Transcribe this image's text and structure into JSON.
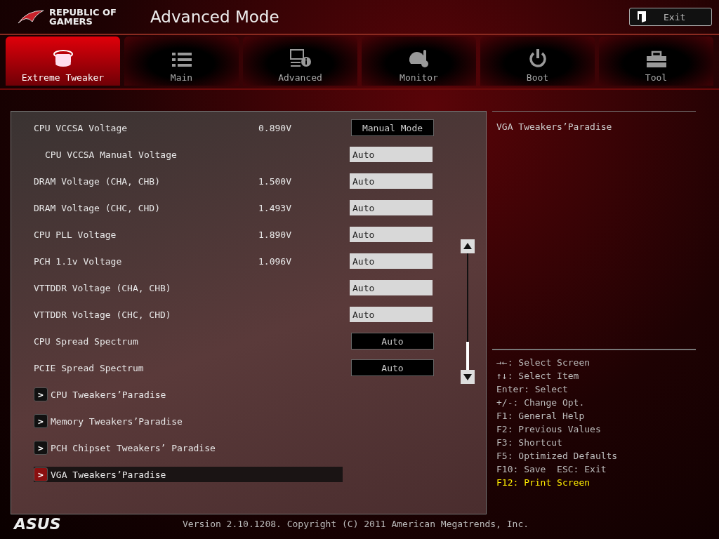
{
  "header": {
    "logo_line1": "REPUBLIC OF",
    "logo_line2": "GAMERS",
    "title": "Advanced Mode",
    "exit_button": "Exit"
  },
  "tabs": [
    {
      "label": "Extreme Tweaker",
      "kind": "tweaker",
      "selected": true
    },
    {
      "label": "Main",
      "kind": "list",
      "selected": false
    },
    {
      "label": "Advanced",
      "kind": "info",
      "selected": false
    },
    {
      "label": "Monitor",
      "kind": "gauge",
      "selected": false
    },
    {
      "label": "Boot",
      "kind": "power",
      "selected": false
    },
    {
      "label": "Tool",
      "kind": "toolbox",
      "selected": false
    }
  ],
  "settings": [
    {
      "kind": "dropdown",
      "name": "CPU VCCSA Voltage",
      "reading": "0.890V",
      "value": "Manual Mode",
      "children": [
        {
          "kind": "input",
          "name": "CPU VCCSA Manual Voltage",
          "value": "Auto"
        }
      ]
    },
    {
      "kind": "input",
      "name": "DRAM Voltage (CHA, CHB)",
      "reading": "1.500V",
      "value": "Auto"
    },
    {
      "kind": "input",
      "name": "DRAM Voltage (CHC, CHD)",
      "reading": "1.493V",
      "value": "Auto"
    },
    {
      "kind": "input",
      "name": "CPU PLL Voltage",
      "reading": "1.890V",
      "value": "Auto"
    },
    {
      "kind": "input",
      "name": "PCH 1.1v Voltage",
      "reading": "1.096V",
      "value": "Auto"
    },
    {
      "kind": "input",
      "name": "VTTDDR Voltage (CHA, CHB)",
      "value": "Auto"
    },
    {
      "kind": "input",
      "name": "VTTDDR Voltage (CHC, CHD)",
      "value": "Auto"
    },
    {
      "kind": "dropdown",
      "name": "CPU Spread Spectrum",
      "value": "Auto"
    },
    {
      "kind": "dropdown",
      "name": "PCIE Spread Spectrum",
      "value": "Auto"
    },
    {
      "kind": "submenu",
      "name": "CPU Tweakers’Paradise",
      "arrow": ">",
      "selected": false
    },
    {
      "kind": "submenu",
      "name": "Memory Tweakers’Paradise",
      "arrow": ">",
      "selected": false
    },
    {
      "kind": "submenu",
      "name": "PCH Chipset Tweakers’ Paradise",
      "arrow": ">",
      "selected": false
    },
    {
      "kind": "submenu",
      "name": "VGA Tweakers’Paradise",
      "arrow": ">",
      "selected": true
    }
  ],
  "help": {
    "text": "VGA Tweakers’Paradise"
  },
  "keys": [
    {
      "text": "→←: Select Screen",
      "highlighted": false
    },
    {
      "text": "↑↓: Select Item",
      "highlighted": false
    },
    {
      "text": "Enter: Select",
      "highlighted": false
    },
    {
      "text": "+/-: Change Opt.",
      "highlighted": false
    },
    {
      "text": "F1: General Help",
      "highlighted": false
    },
    {
      "text": "F2: Previous Values",
      "highlighted": false
    },
    {
      "text": "F3: Shortcut",
      "highlighted": false
    },
    {
      "text": "F5: Optimized Defaults",
      "highlighted": false
    },
    {
      "text": "F10: Save  ESC: Exit",
      "highlighted": false
    },
    {
      "text": "F12: Print Screen",
      "highlighted": true
    }
  ],
  "footer": {
    "brand": "ASUS",
    "version": "Version 2.10.1208. Copyright (C) 2011 American Megatrends, Inc."
  }
}
